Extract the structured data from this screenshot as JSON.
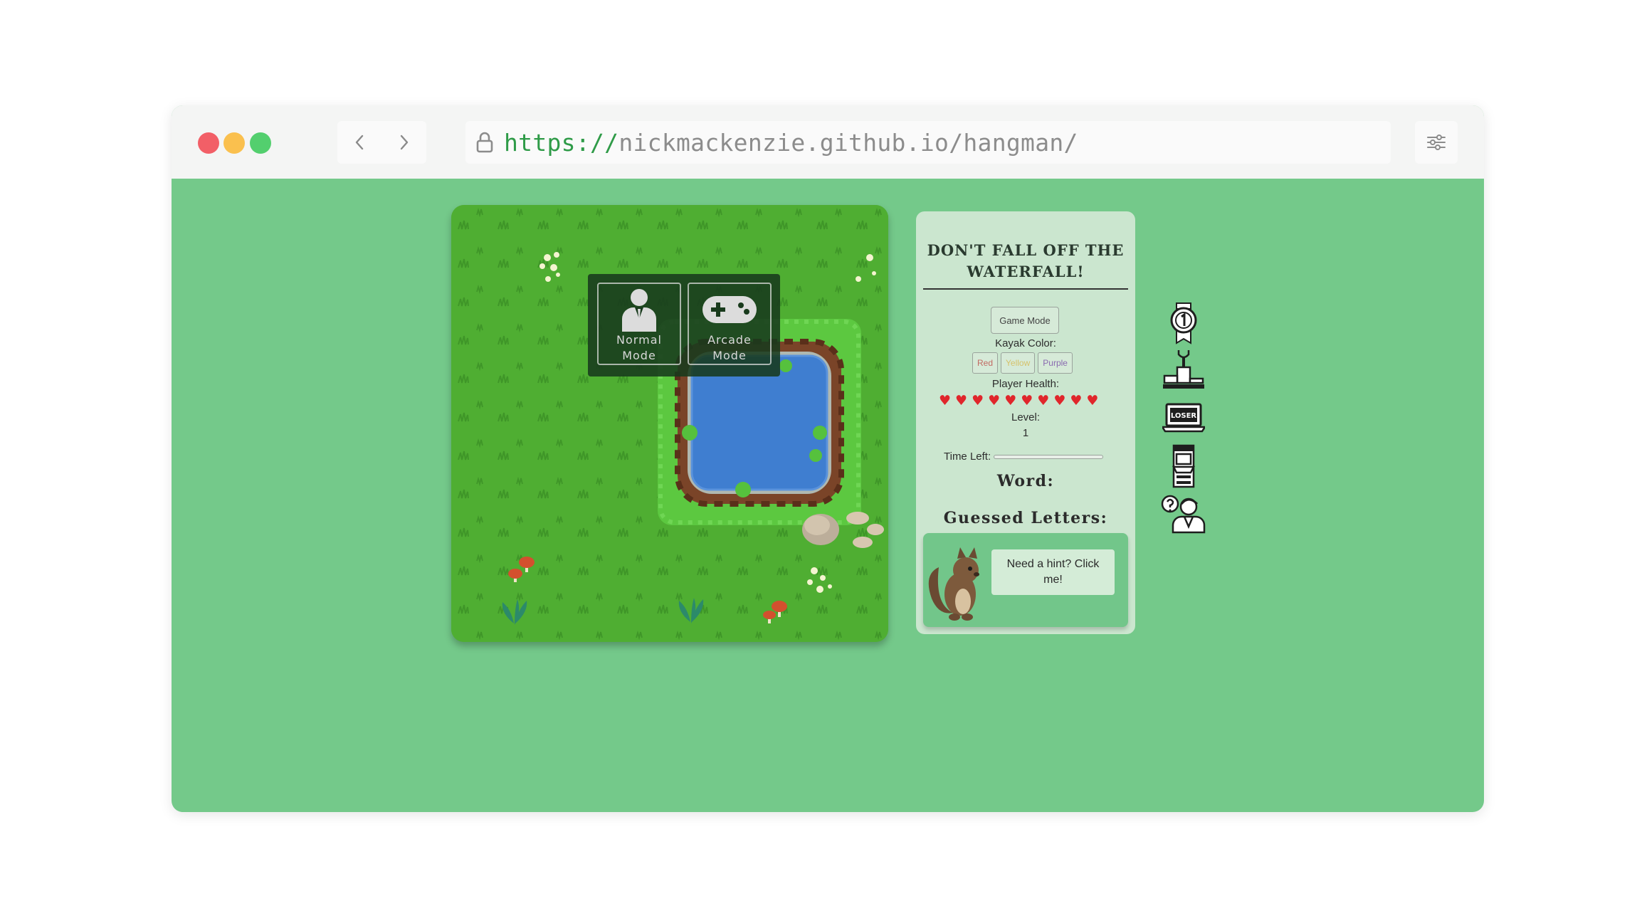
{
  "browser": {
    "url_scheme": "https://",
    "url_host": "nickmackenzie.github.io/hangman/",
    "icons": [
      "back-icon",
      "forward-icon",
      "lock-icon",
      "settings-sliders-icon"
    ]
  },
  "game": {
    "modes": [
      {
        "label": "Normal Mode",
        "icon": "person-suit-icon"
      },
      {
        "label": "Arcade Mode",
        "icon": "gamepad-icon"
      }
    ]
  },
  "panel": {
    "title": "DON'T FALL OFF THE WATERFALL!",
    "game_mode_button": "Game Mode",
    "kayak_color_label": "Kayak Color:",
    "kayak_colors": [
      "Red",
      "Yellow",
      "Purple"
    ],
    "player_health_label": "Player Health:",
    "health": 10,
    "level_label": "Level:",
    "level_value": "1",
    "time_left_label": "Time Left:",
    "word_label": "Word:",
    "guessed_label": "Guessed Letters:",
    "hint_text": "Need a hint? Click me!"
  },
  "side_icons": [
    "first-place-medal-icon",
    "trophy-podium-icon",
    "loser-laptop-icon",
    "arcade-machine-icon",
    "help-person-icon"
  ],
  "side_icon_text": {
    "loser": "LOSER"
  },
  "colors": {
    "page_bg": "#74c98a",
    "panel_bg": "#cbe6cf",
    "heart": "#e0262b",
    "url_scheme": "#2f9b48"
  }
}
